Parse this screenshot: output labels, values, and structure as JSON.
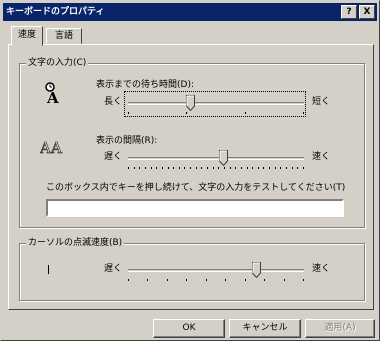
{
  "window": {
    "title": "キーボードのプロパティ",
    "help_glyph": "?",
    "close_glyph": "X"
  },
  "tabs": [
    {
      "label": "速度",
      "active": true
    },
    {
      "label": "言語",
      "active": false
    }
  ],
  "char_input": {
    "group_label": "文字の入力(C)",
    "delay": {
      "label": "表示までの待ち時間(D):",
      "min_label": "長く",
      "max_label": "短く",
      "position_ticks": 2,
      "tick_count": 4,
      "icon": "clock-a-icon"
    },
    "rate": {
      "label": "表示の間隔(R):",
      "min_label": "遅く",
      "max_label": "速く",
      "position_ticks": 11,
      "tick_count": 32,
      "icon": "double-a-icon"
    },
    "test_label": "このボックス内でキーを押し続けて、文字の入力をテストしてください(T)",
    "test_value": ""
  },
  "cursor_blink": {
    "group_label": "カーソルの点滅速度(B)",
    "min_label": "遅く",
    "max_label": "速く",
    "position_ticks": 7,
    "tick_count": 10,
    "icon": "cursor-bar-icon"
  },
  "buttons": {
    "ok": "OK",
    "cancel": "キャンセル",
    "apply": "適用(A)"
  }
}
